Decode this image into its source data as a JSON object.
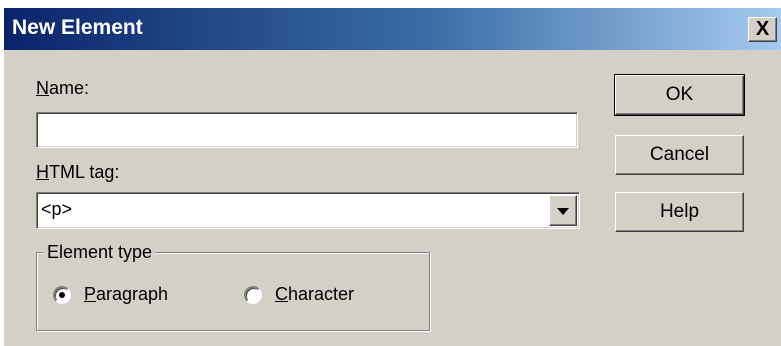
{
  "dialog": {
    "title": "New Element",
    "close_label": "X",
    "name_label": {
      "underline": "N",
      "rest": "ame:"
    },
    "name_value": "",
    "html_tag_label": {
      "underline": "H",
      "rest": "TML tag:"
    },
    "html_tag_value": "<p>",
    "group_label": "Element type",
    "radio_paragraph": {
      "underline": "P",
      "rest": "aragraph",
      "selected": true
    },
    "radio_character": {
      "underline": "C",
      "rest": "haracter",
      "selected": false
    },
    "ok_label": "OK",
    "cancel_label": "Cancel",
    "help_label": "Help"
  }
}
